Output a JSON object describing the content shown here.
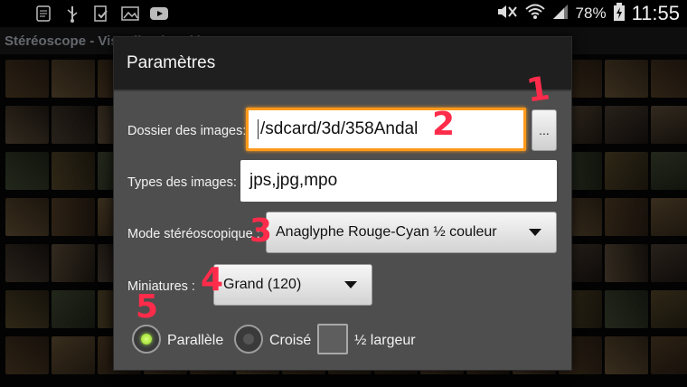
{
  "status_bar": {
    "left_icons": [
      "notes-icon",
      "usb-icon",
      "clipboard-icon",
      "image-icon",
      "youtube-icon"
    ],
    "battery": "78%",
    "time": "11:55"
  },
  "app": {
    "title": "Stéréoscope - Visualisation d'images 3D"
  },
  "dialog": {
    "title": "Paramètres",
    "folder": {
      "label": "Dossier des images:",
      "value": "/sdcard/3d/358Andal",
      "browse_label": "..."
    },
    "types": {
      "label": "Types des images:",
      "value": "jps,jpg,mpo"
    },
    "stereo_mode": {
      "label": "Mode stéréoscopique :",
      "value": "Anaglyphe Rouge-Cyan ½ couleur"
    },
    "thumbnails": {
      "label": "Miniatures :",
      "value": "Grand (120)"
    },
    "options": {
      "parallel": {
        "label": "Parallèle",
        "selected": true
      },
      "crossed": {
        "label": "Croisé",
        "selected": false
      },
      "half_width": {
        "label": "½ largeur",
        "checked": false
      }
    }
  },
  "annotations": [
    "1",
    "2",
    "3",
    "4",
    "5"
  ],
  "colors": {
    "focus": "#ff9a1a",
    "annotation": "#ff2b4a",
    "radio_on": "#8fd321"
  }
}
